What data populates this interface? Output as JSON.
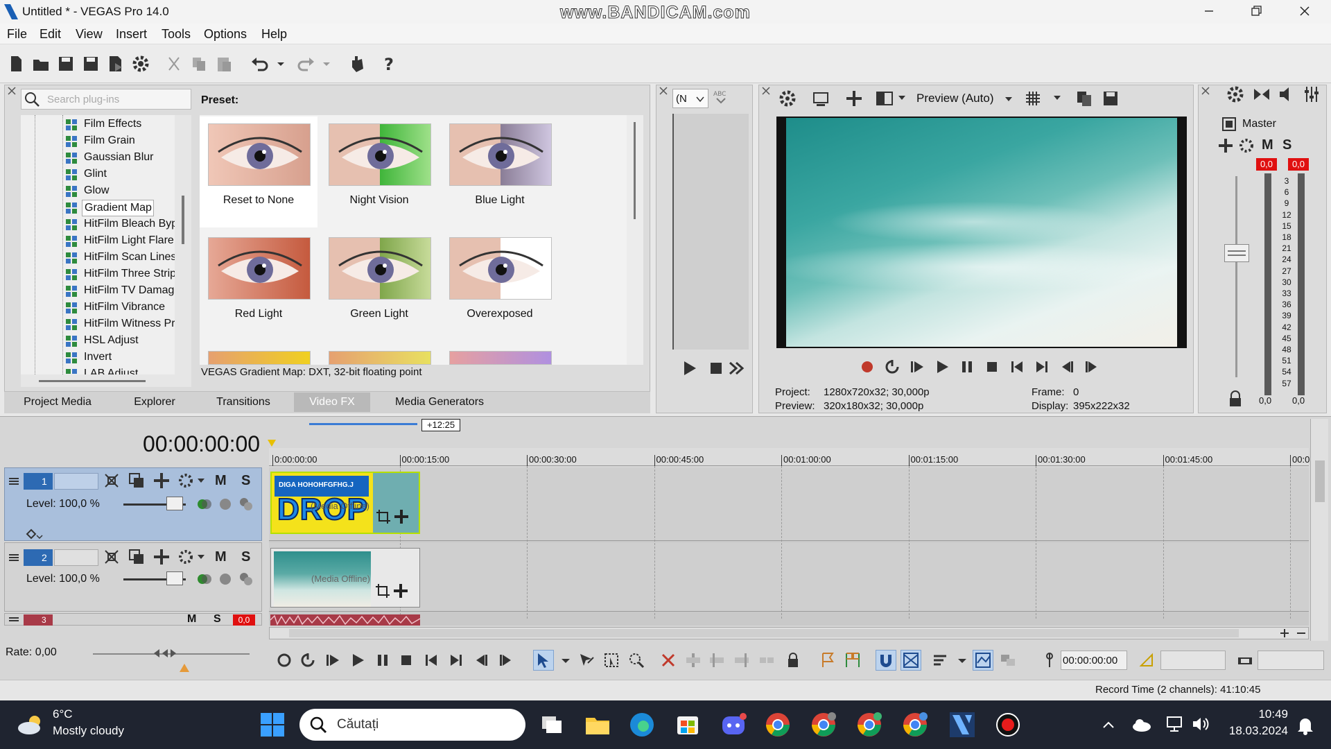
{
  "window": {
    "title": "Untitled * - VEGAS Pro 14.0",
    "watermark": "www.BANDICAM.com"
  },
  "menu": [
    "File",
    "Edit",
    "View",
    "Insert",
    "Tools",
    "Options",
    "Help"
  ],
  "plugins": {
    "search_placeholder": "Search plug-ins",
    "items": [
      "Film Effects",
      "Film Grain",
      "Gaussian Blur",
      "Glint",
      "Glow",
      "Gradient Map",
      "HitFilm Bleach Byp",
      "HitFilm Light Flare:",
      "HitFilm Scan Lines",
      "HitFilm Three Strip",
      "HitFilm TV Damage",
      "HitFilm Vibrance",
      "HitFilm Witness Pr",
      "HSL Adjust",
      "Invert",
      "LAB Adjust"
    ],
    "selected": "Gradient Map"
  },
  "presets": {
    "header": "Preset:",
    "items": [
      "Reset to None",
      "Night Vision",
      "Blue Light",
      "Red  Light",
      "Green  Light",
      "Overexposed"
    ],
    "status": "VEGAS Gradient Map: DXT, 32-bit floating point"
  },
  "tabs": [
    "Project Media",
    "Explorer",
    "Transitions",
    "Video FX",
    "Media Generators"
  ],
  "active_tab": "Video FX",
  "trimmer": {
    "dropdown": "(N"
  },
  "preview": {
    "mode": "Preview (Auto)",
    "project_label": "Project:",
    "project_value": "1280x720x32; 30,000p",
    "preview_label": "Preview:",
    "preview_value": "320x180x32; 30,000p",
    "frame_label": "Frame:",
    "frame_value": "0",
    "display_label": "Display:",
    "display_value": "395x222x32"
  },
  "mixer": {
    "label": "Master",
    "peak_l": "0,0",
    "peak_r": "0,0",
    "scale": [
      "3",
      "6",
      "9",
      "12",
      "15",
      "18",
      "21",
      "24",
      "27",
      "30",
      "33",
      "36",
      "39",
      "42",
      "45",
      "48",
      "51",
      "54",
      "57"
    ],
    "bottom_l": "0,0",
    "bottom_r": "0,0",
    "M": "M",
    "S": "S"
  },
  "timeline": {
    "timecode": "00:00:00:00",
    "length_badge": "+12:25",
    "ruler": [
      "0:00:00:00",
      "00:00:15:00",
      "00:00:30:00",
      "00:00:45:00",
      "00:01:00:00",
      "00:01:15:00",
      "00:01:30:00",
      "00:01:45:00",
      "00:0"
    ],
    "tracks": [
      {
        "num": "1",
        "level": "Level: 100,0 %",
        "clip_title": "DIGA HOHOHFGFHG.J",
        "clip_text": "DROP",
        "offline": "(Media Offline)"
      },
      {
        "num": "2",
        "level": "Level: 100,0 %",
        "offline": "(Media Offline)"
      },
      {
        "num": "3",
        "peak": "0,0"
      }
    ],
    "M": "M",
    "S": "S",
    "rate": "Rate: 0,00",
    "cursor_time": "00:00:00:00",
    "record_time": "Record Time (2 channels): 41:10:45"
  },
  "taskbar": {
    "weather_temp": "6°C",
    "weather_desc": "Mostly cloudy",
    "search": "Căutați",
    "time": "10:49",
    "date": "18.03.2024"
  }
}
